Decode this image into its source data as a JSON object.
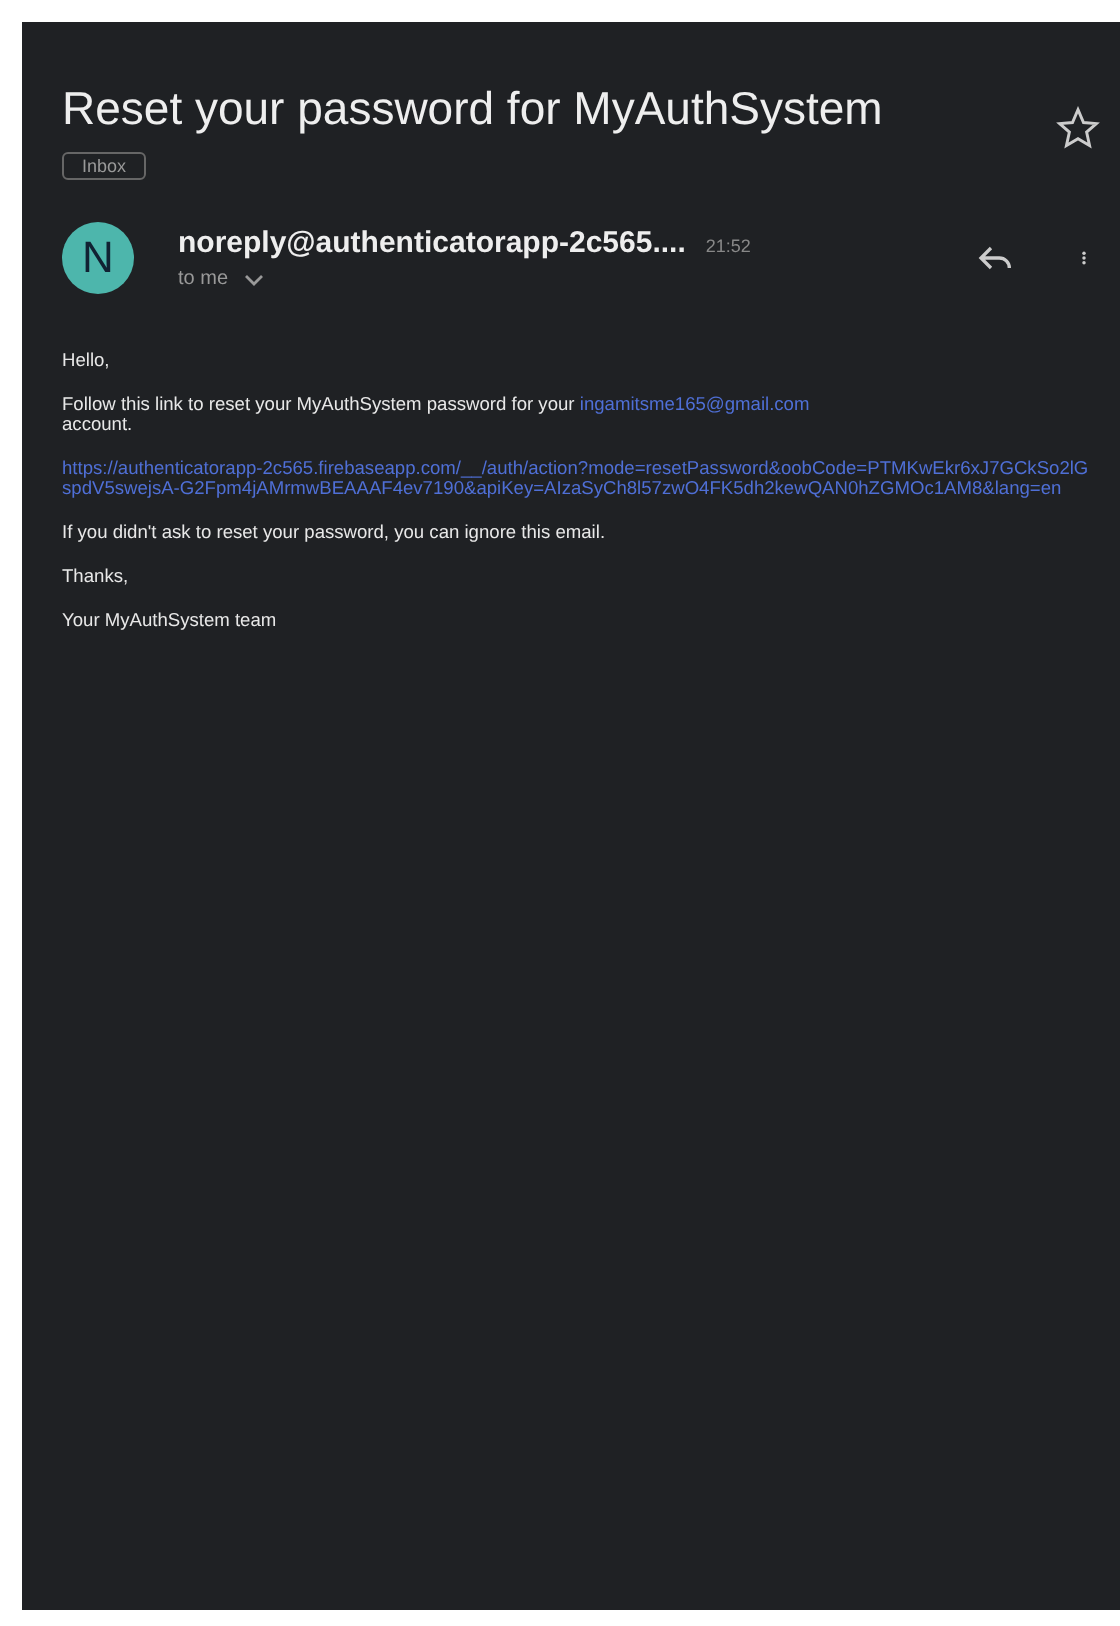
{
  "subject": "Reset your password for MyAuthSystem",
  "label": "Inbox",
  "starred": false,
  "sender": {
    "initial": "N",
    "name": "noreply@authenticatorapp-2c565....",
    "time": "21:52",
    "recipient": "to me"
  },
  "body": {
    "greeting": "Hello,",
    "intro": "Follow this link to reset your MyAuthSystem password for your",
    "email": "ingamitsme165@gmail.com",
    "intro_end": "account.",
    "link": "https://authenticatorapp-2c565.firebaseapp.com/__/auth/action?mode=resetPassword&oobCode=PTMKwEkr6xJ7GCkSo2lGspdV5swejsA-G2Fpm4jAMrmwBEAAAF4ev7190&apiKey=AIzaSyCh8l57zwO4FK5dh2kewQAN0hZGMOc1AM8&lang=en",
    "ignore": "If you didn't ask to reset your password, you can ignore this email.",
    "thanks": "Thanks,",
    "signature": "Your MyAuthSystem team"
  }
}
